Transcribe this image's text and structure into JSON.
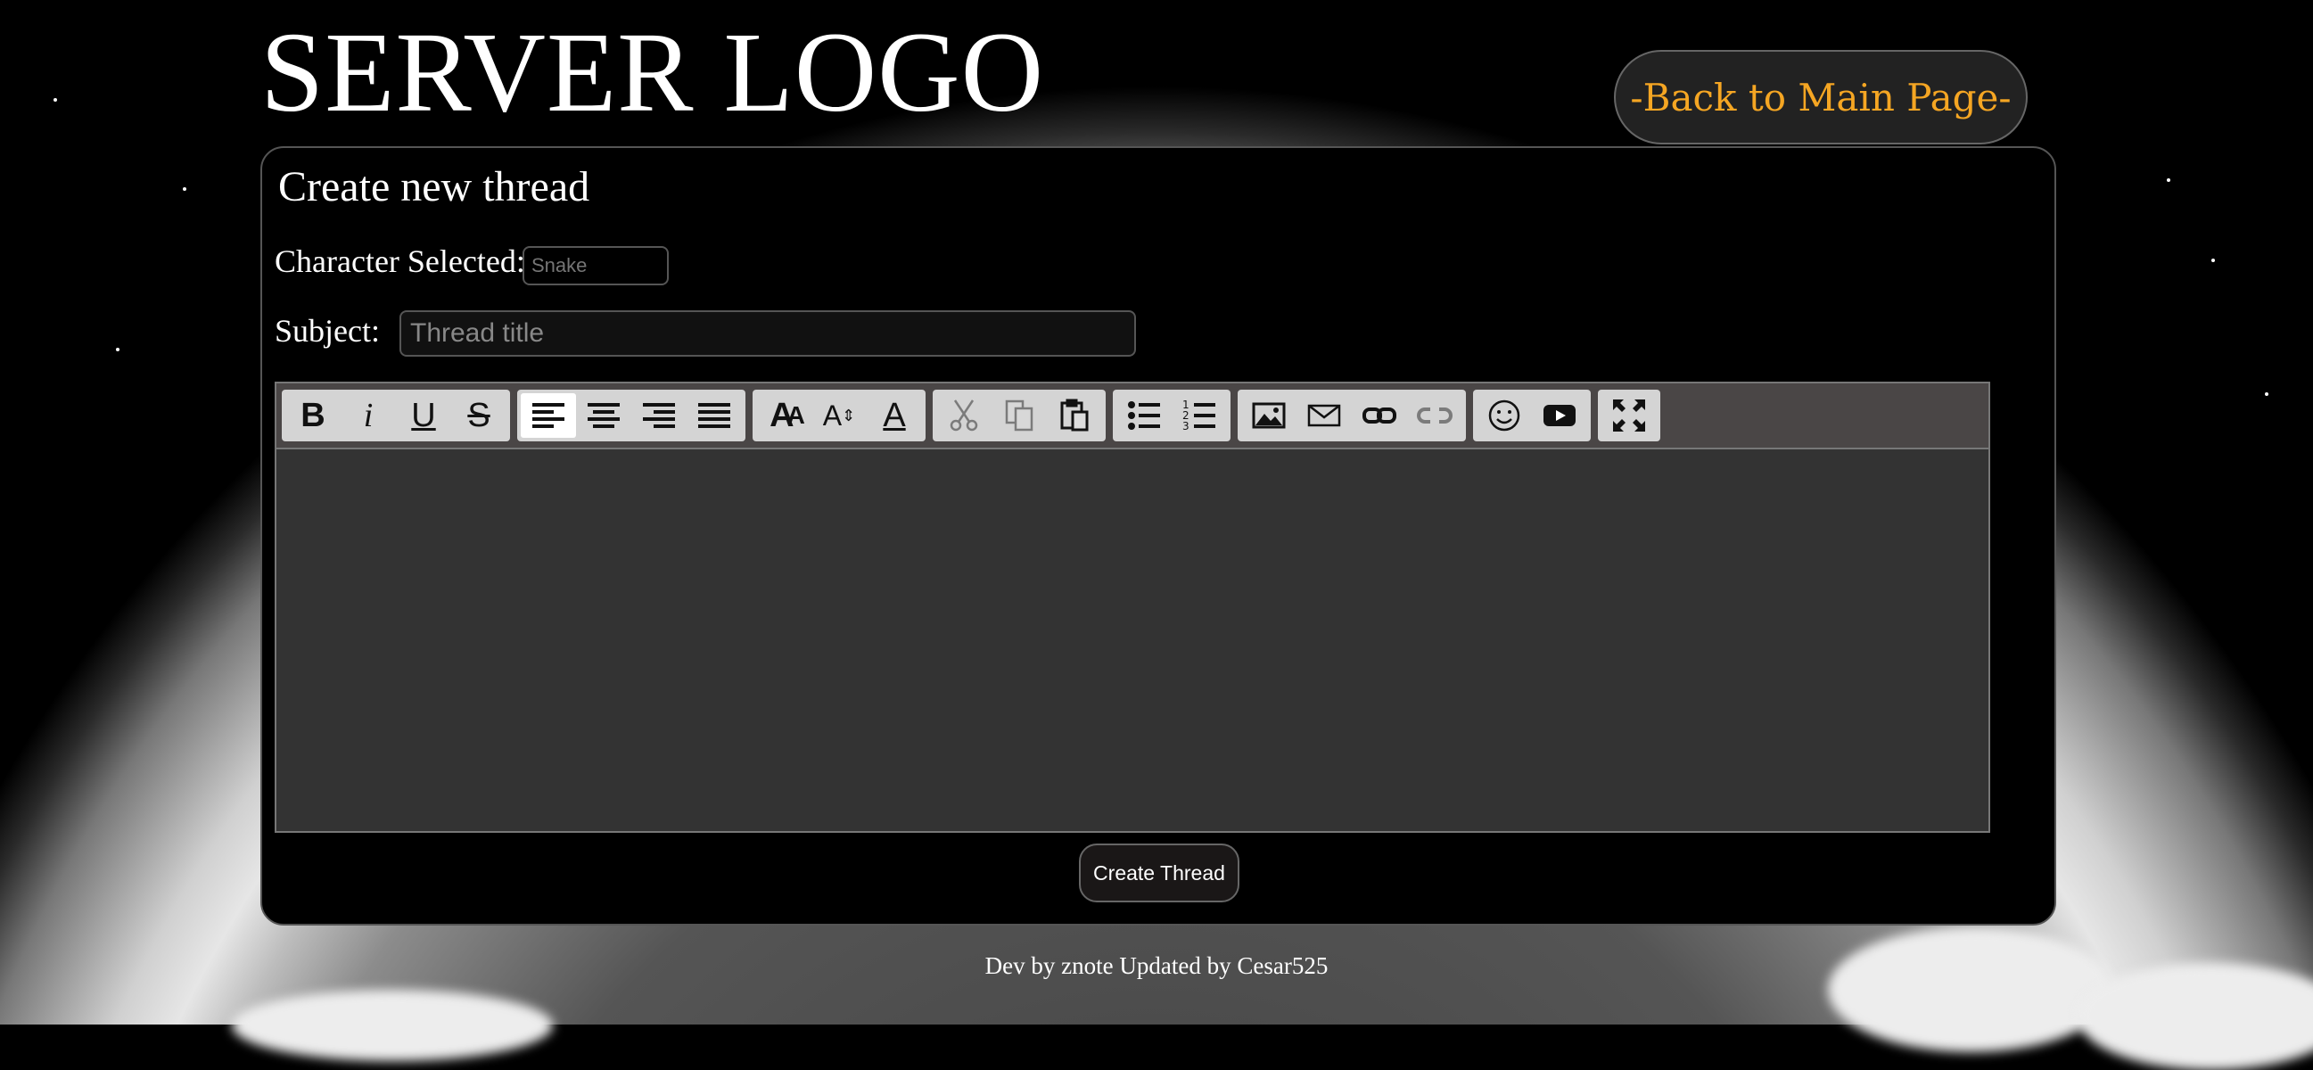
{
  "header": {
    "logo": "SERVER LOGO",
    "back_link": "-Back to Main Page-"
  },
  "form": {
    "title": "Create new thread",
    "character_label": "Character Selected:",
    "character_value": "Snake",
    "subject_label": "Subject:",
    "subject_placeholder": "Thread title",
    "submit_label": "Create Thread"
  },
  "toolbar": {
    "groups": [
      [
        "bold-icon",
        "italic-icon",
        "underline-icon",
        "strikethrough-icon"
      ],
      [
        "align-left-icon",
        "align-center-icon",
        "align-right-icon",
        "justify-icon"
      ],
      [
        "font-icon",
        "font-size-icon",
        "font-color-icon"
      ],
      [
        "cut-icon",
        "copy-icon",
        "paste-icon"
      ],
      [
        "bullet-list-icon",
        "ordered-list-icon"
      ],
      [
        "image-icon",
        "email-icon",
        "link-icon",
        "unlink-icon"
      ],
      [
        "emoticon-icon",
        "youtube-icon"
      ],
      [
        "maximize-icon"
      ]
    ],
    "bold": "B",
    "italic": "i",
    "underline": "U",
    "strike": "S",
    "font_size_glyph": "A",
    "font_glyph": "A",
    "color_glyph": "A"
  },
  "footer": {
    "credit": "Dev by znote Updated by Cesar525"
  },
  "colors": {
    "accent": "#f5a623",
    "panel_bg": "#000000",
    "editor_bg": "#333333",
    "toolbar_bg": "#4a4646"
  }
}
